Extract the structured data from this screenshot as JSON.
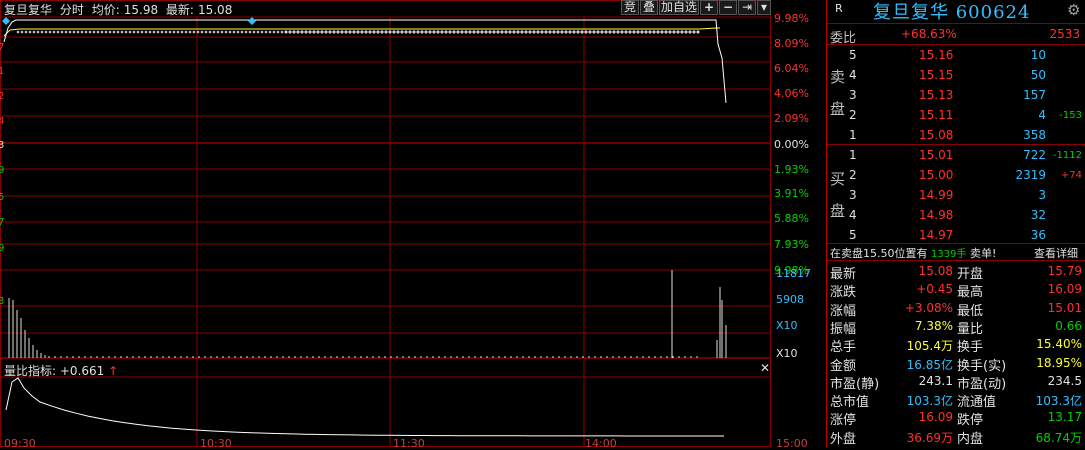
{
  "header": {
    "stock_name": "复旦复华",
    "mode": "分时",
    "avg_label": "均价:",
    "avg_value": "15.98",
    "latest_label": "最新:",
    "latest_value": "15.08"
  },
  "toolbar": {
    "bid_label": "竞",
    "board_label": "叠",
    "add_fav_label": "加自选",
    "plus": "+",
    "minus": "−",
    "next": "⇥",
    "menu": "▾"
  },
  "price_axis": {
    "right_pcts": [
      "9.98%",
      "8.09%",
      "6.04%",
      "4.06%",
      "2.09%",
      "0.00%",
      "1.93%",
      "3.91%",
      "5.88%",
      "7.93%",
      "9.98%"
    ],
    "left_digits": [
      "7",
      "1",
      "2",
      "4",
      "3",
      "9",
      "5",
      "7",
      "9",
      "3"
    ]
  },
  "volume_axis": {
    "labels": [
      "11817",
      "5908",
      "X10"
    ]
  },
  "indicator": {
    "label": "量比指标:",
    "value": "+0.661",
    "arrow": "↑",
    "close": "✕"
  },
  "time_axis": {
    "labels": [
      "09:30",
      "10:30",
      "11:30",
      "14:00",
      "15:00"
    ]
  },
  "quote": {
    "r_badge": "R",
    "name": "复旦复华",
    "code": "600624",
    "gear": "⚙",
    "weibi_label": "委比",
    "weibi_value": "+68.63%",
    "weicha_value": "2533",
    "sell_label_1": "卖",
    "sell_label_2": "盘",
    "buy_label_1": "买",
    "buy_label_2": "盘",
    "asks": [
      {
        "level": "5",
        "price": "15.16",
        "vol": "10",
        "chg": ""
      },
      {
        "level": "4",
        "price": "15.15",
        "vol": "50",
        "chg": ""
      },
      {
        "level": "3",
        "price": "15.13",
        "vol": "157",
        "chg": ""
      },
      {
        "level": "2",
        "price": "15.11",
        "vol": "4",
        "chg": "-153"
      },
      {
        "level": "1",
        "price": "15.08",
        "vol": "358",
        "chg": ""
      }
    ],
    "bids": [
      {
        "level": "1",
        "price": "15.01",
        "vol": "722",
        "chg": "-1112"
      },
      {
        "level": "2",
        "price": "15.00",
        "vol": "2319",
        "chg": "+74"
      },
      {
        "level": "3",
        "price": "14.99",
        "vol": "3",
        "chg": ""
      },
      {
        "level": "4",
        "price": "14.98",
        "vol": "32",
        "chg": ""
      },
      {
        "level": "5",
        "price": "14.97",
        "vol": "36",
        "chg": ""
      }
    ],
    "notice_pre": "在卖盘15.50位置有",
    "notice_vol": "1339手",
    "notice_post": "卖单!",
    "notice_link": "查看详细",
    "stats": [
      {
        "l1": "最新",
        "v1": "15.08",
        "c1": "red",
        "l2": "开盘",
        "v2": "15.79",
        "c2": "red"
      },
      {
        "l1": "涨跌",
        "v1": "+0.45",
        "c1": "red",
        "l2": "最高",
        "v2": "16.09",
        "c2": "red"
      },
      {
        "l1": "涨幅",
        "v1": "+3.08%",
        "c1": "red",
        "l2": "最低",
        "v2": "15.01",
        "c2": "red"
      },
      {
        "l1": "振幅",
        "v1": "7.38%",
        "c1": "yellow",
        "l2": "量比",
        "v2": "0.66",
        "c2": "green"
      },
      {
        "l1": "总手",
        "v1": "105.4万",
        "c1": "yellow",
        "l2": "换手",
        "v2": "15.40%",
        "c2": "yellow"
      },
      {
        "l1": "金额",
        "v1": "16.85亿",
        "c1": "cyan",
        "l2": "换手(实)",
        "v2": "18.95%",
        "c2": "yellow"
      },
      {
        "l1": "市盈(静)",
        "v1": "243.1",
        "c1": "white",
        "l2": "市盈(动)",
        "v2": "234.5",
        "c2": "white"
      },
      {
        "l1": "总市值",
        "v1": "103.3亿",
        "c1": "cyan",
        "l2": "流通值",
        "v2": "103.3亿",
        "c2": "cyan"
      },
      {
        "l1": "涨停",
        "v1": "16.09",
        "c1": "red",
        "l2": "跌停",
        "v2": "13.17",
        "c2": "green"
      },
      {
        "l1": "外盘",
        "v1": "36.69万",
        "c1": "red",
        "l2": "内盘",
        "v2": "68.74万",
        "c2": "green"
      }
    ]
  },
  "colors": {
    "grid": "#8a0000",
    "price_line": "#ffffff",
    "avg_line": "#ffff30",
    "up": "#ff3030",
    "down": "#00d000",
    "accent": "#30c0ff"
  }
}
